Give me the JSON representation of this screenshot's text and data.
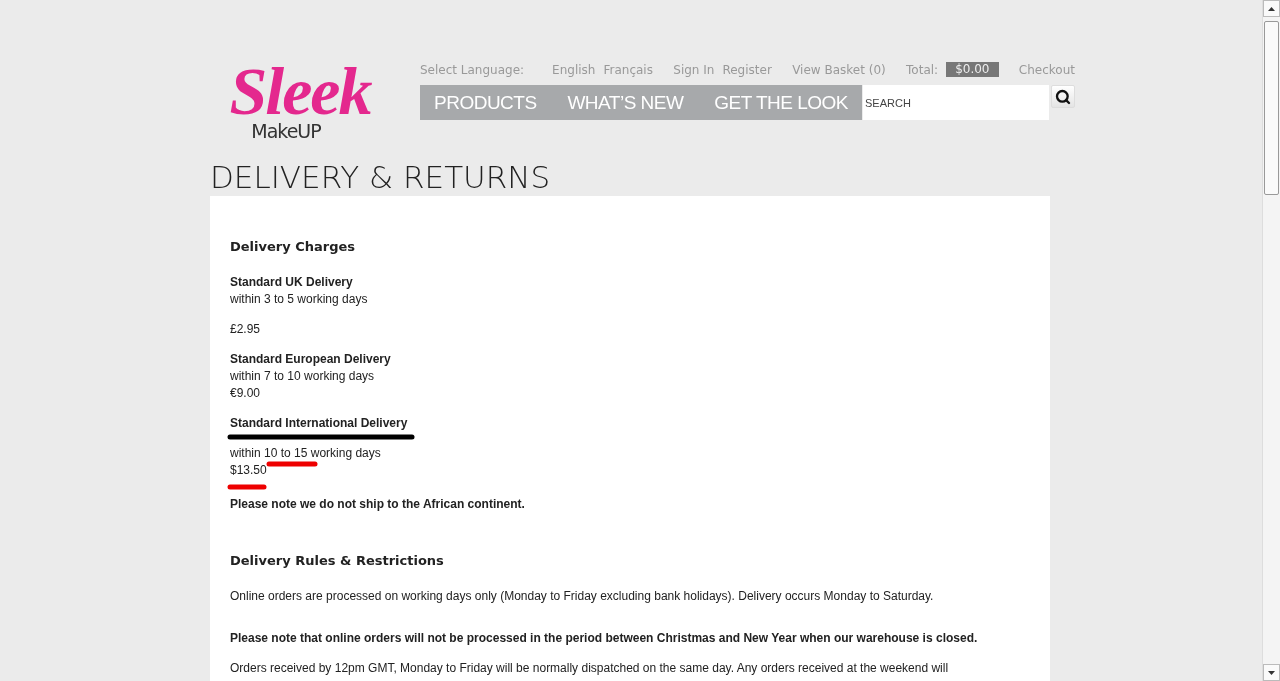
{
  "header": {
    "language_label": "Select Language:",
    "languages": [
      "English",
      "Français"
    ],
    "account_links": [
      "Sign In",
      "Register"
    ],
    "basket": "View Basket (0)",
    "total_label": "Total:",
    "total_value": "$0.00",
    "checkout": "Checkout"
  },
  "logo": {
    "script": "Sleek",
    "sub": "MakeUP"
  },
  "nav": [
    "PRODUCTS",
    "WHAT’S NEW",
    "GET THE LOOK"
  ],
  "search": {
    "placeholder": "SEARCH"
  },
  "page_title": "DELIVERY & RETURNS",
  "sections": [
    {
      "heading": "Delivery Charges",
      "groups": [
        {
          "lines": [
            {
              "text": "Standard UK Delivery",
              "bold": true
            },
            {
              "text": "within 3 to 5 working days",
              "bold": false
            }
          ]
        },
        {
          "lines": [
            {
              "text": "£2.95",
              "bold": false
            }
          ]
        },
        {
          "lines": [
            {
              "text": "Standard European Delivery",
              "bold": true
            },
            {
              "text": "within 7 to 10 working days",
              "bold": false
            },
            {
              "text": "€9.00",
              "bold": false
            }
          ]
        },
        {
          "lines": [
            {
              "text": "Standard International Delivery",
              "bold": true
            }
          ]
        },
        {
          "lines": [
            {
              "text": "within 10 to 15 working days",
              "bold": false
            },
            {
              "text": "$13.50",
              "bold": false
            }
          ]
        },
        {
          "lines": [
            {
              "text": "Please note we do not ship to the African continent.",
              "bold": true
            }
          ]
        }
      ]
    },
    {
      "heading": "Delivery Rules & Restrictions",
      "groups": [
        {
          "lines": [
            {
              "text": "Online orders are processed on working days only (Monday to Friday excluding bank holidays). Delivery occurs Monday to Saturday.",
              "bold": false
            }
          ]
        },
        {
          "lines": [
            {
              "text": "Please note that online orders will not be processed in the period between Christmas and New Year when our warehouse is closed.",
              "bold": true
            }
          ]
        },
        {
          "lines": [
            {
              "text": "Orders received by 12pm GMT, Monday to Friday will be normally dispatched on the same day. Any orders received at the weekend will",
              "bold": false
            }
          ]
        }
      ]
    }
  ]
}
